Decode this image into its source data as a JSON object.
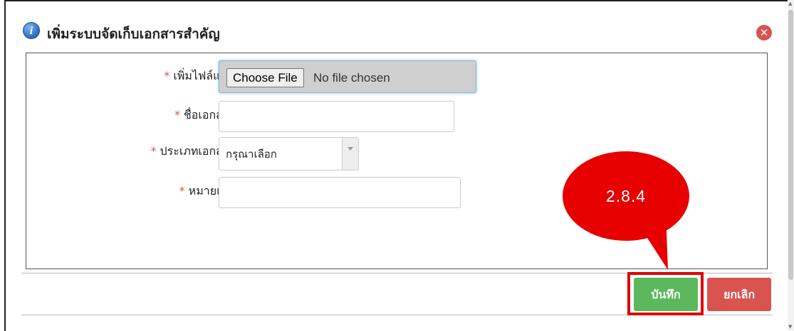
{
  "dialog": {
    "title": "เพิ่มระบบจัดเก็บเอกสารสำคัญ",
    "info_icon": "info-icon",
    "close_icon": "close-icon",
    "close_glyph": "✕"
  },
  "form": {
    "attachment": {
      "required_mark": "*",
      "label": "เพิ่มไฟล์แนบ :",
      "button_label": "Choose File",
      "status": "No file chosen"
    },
    "document_name": {
      "required_mark": "*",
      "label": "ชื่อเอกสาร :",
      "value": ""
    },
    "document_type": {
      "required_mark": "*",
      "label": "ประเภทเอกสาร :",
      "selected": "กรุณาเลือก"
    },
    "remark": {
      "required_mark": "*",
      "label": "หมายเหตุ :",
      "value": ""
    }
  },
  "footer": {
    "save_label": "บันทึก",
    "cancel_label": "ยกเลิก"
  },
  "annotation": {
    "callout_text": "2.8.4"
  },
  "colors": {
    "required": "#d9534f",
    "save": "#5cb85c",
    "cancel": "#d9534f",
    "callout": "#e60000",
    "highlight": "#e00000"
  }
}
